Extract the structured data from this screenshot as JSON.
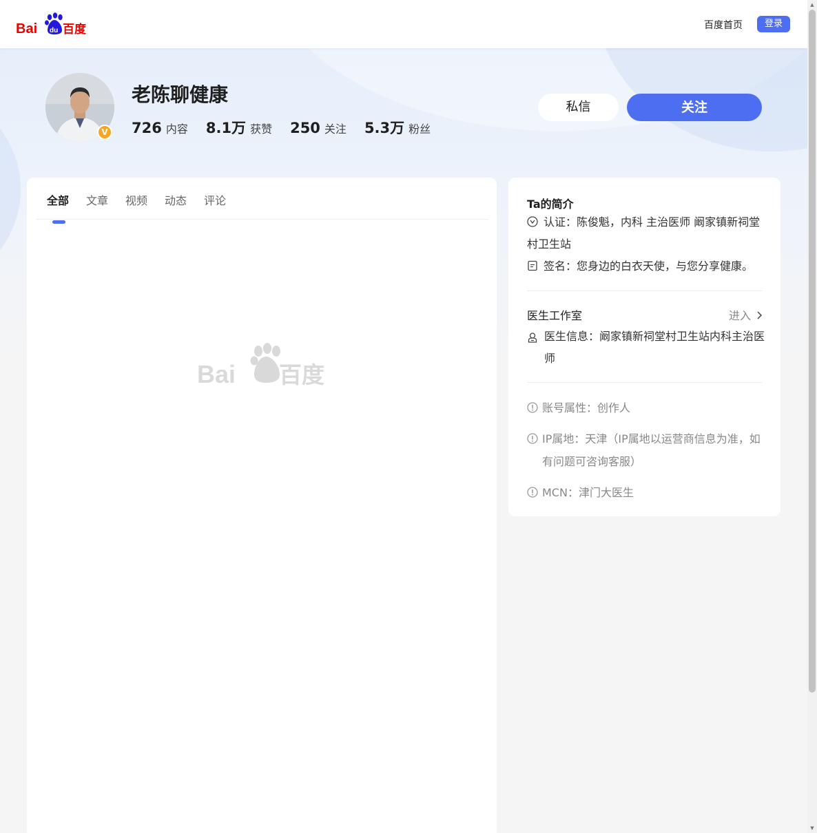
{
  "header": {
    "logo_text": "Bai du 百度",
    "home_link": "百度首页",
    "login_button": "登录"
  },
  "profile": {
    "name": "老陈聊健康",
    "badge": "V",
    "stats": [
      {
        "num": "726",
        "label": "内容"
      },
      {
        "num": "8.1万",
        "label": "获赞"
      },
      {
        "num": "250",
        "label": "关注"
      },
      {
        "num": "5.3万",
        "label": "粉丝"
      }
    ],
    "message_button": "私信",
    "follow_button": "关注"
  },
  "tabs": [
    "全部",
    "文章",
    "视频",
    "动态",
    "评论"
  ],
  "active_tab": "全部",
  "sidebar": {
    "intro_title": "Ta的简介",
    "certification": "认证：陈俊魁，内科 主治医师 阚家镇新祠堂村卫生站",
    "signature": "签名：您身边的白衣天使，与您分享健康。",
    "studio_title": "医生工作室",
    "studio_enter": "进入",
    "doctor_info": "医生信息：阚家镇新祠堂村卫生站内科主治医师",
    "account_type": "账号属性：创作人",
    "ip_location_line1": "IP属地：天津（IP属地以运营商信息为准，如",
    "ip_location_line2": "有问题可咨询客服）",
    "mcn": "MCN：津门大医生"
  },
  "colors": {
    "brand_blue": "#4e6ef2",
    "baidu_red": "#e10601",
    "baidu_blue": "#2319dc",
    "badge_orange": "#f5a623"
  }
}
